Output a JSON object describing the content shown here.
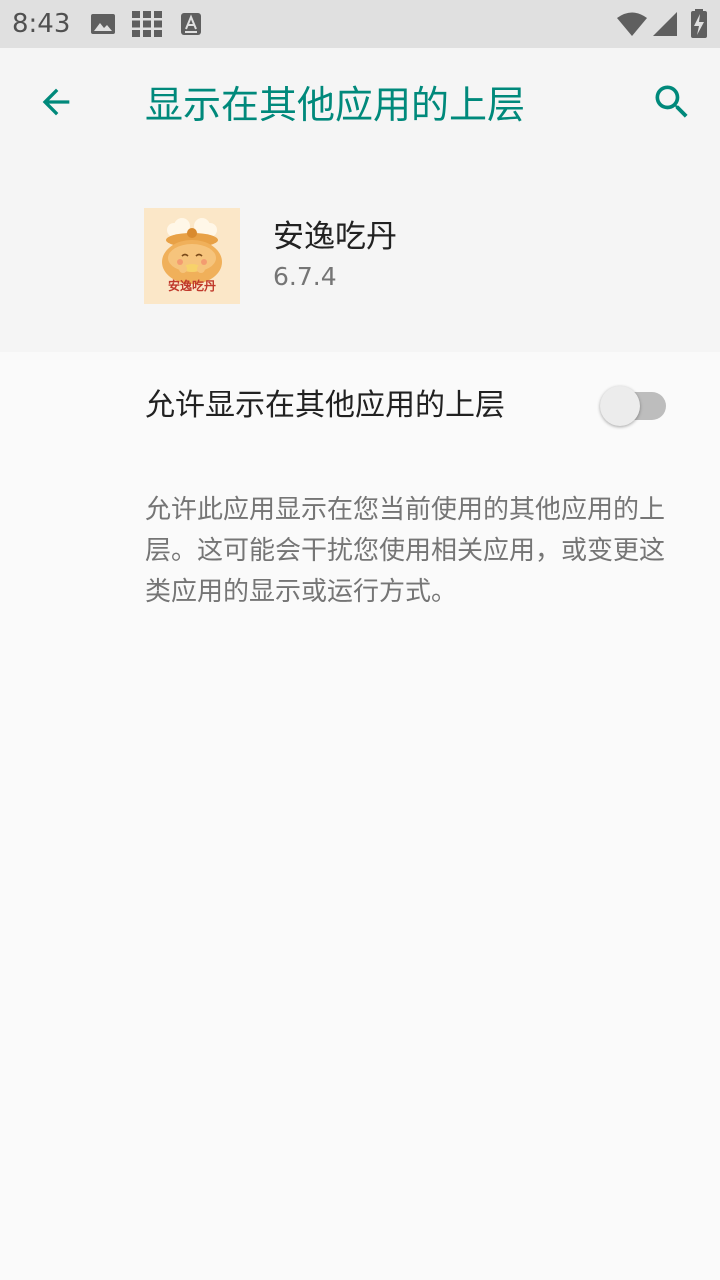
{
  "status_bar": {
    "time": "8:43",
    "icons": [
      "image-icon",
      "grid-icon",
      "accessibility-a-icon",
      "wifi-icon",
      "signal-icon",
      "battery-charging-icon"
    ]
  },
  "app_bar": {
    "title": "显示在其他应用的上层",
    "back_icon": "arrow-back-icon",
    "search_icon": "search-icon",
    "accent_color": "#00897b"
  },
  "app_info": {
    "name": "安逸吃丹",
    "version": "6.7.4",
    "icon_label": "安逸吃丹"
  },
  "permission": {
    "label": "允许显示在其他应用的上层",
    "enabled": false
  },
  "description": "允许此应用显示在您当前使用的其他应用的上层。这可能会干扰您使用相关应用，或变更这类应用的显示或运行方式。"
}
